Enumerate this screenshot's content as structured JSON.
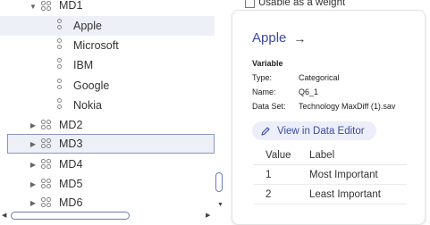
{
  "tree": {
    "items": [
      {
        "label": "MD1",
        "kind": "group",
        "expanded": true
      },
      {
        "label": "Apple",
        "kind": "item",
        "selected": true
      },
      {
        "label": "Microsoft",
        "kind": "item"
      },
      {
        "label": "IBM",
        "kind": "item"
      },
      {
        "label": "Google",
        "kind": "item"
      },
      {
        "label": "Nokia",
        "kind": "item"
      },
      {
        "label": "MD2",
        "kind": "group",
        "expanded": false
      },
      {
        "label": "MD3",
        "kind": "group",
        "expanded": false,
        "focused": true
      },
      {
        "label": "MD4",
        "kind": "group",
        "expanded": false
      },
      {
        "label": "MD5",
        "kind": "group",
        "expanded": false
      },
      {
        "label": "MD6",
        "kind": "group",
        "expanded": false
      }
    ]
  },
  "options": {
    "weight_checkbox_label": "Usable as a weight",
    "weight_checked": false
  },
  "details": {
    "title": "Apple",
    "section_label": "Variable",
    "fields": [
      {
        "key": "Type:",
        "value": "Categorical"
      },
      {
        "key": "Name:",
        "value": "Q6_1"
      },
      {
        "key": "Data Set:",
        "value": "Technology MaxDiff (1).sav"
      }
    ],
    "view_button_label": "View in Data Editor",
    "table": {
      "headers": [
        "Value",
        "Label"
      ],
      "rows": [
        [
          "1",
          "Most Important"
        ],
        [
          "2",
          "Least Important"
        ]
      ]
    }
  },
  "colors": {
    "accent": "#3b4aa1",
    "selected_row": "#eef0f7",
    "focus_border": "#8a93c8"
  }
}
